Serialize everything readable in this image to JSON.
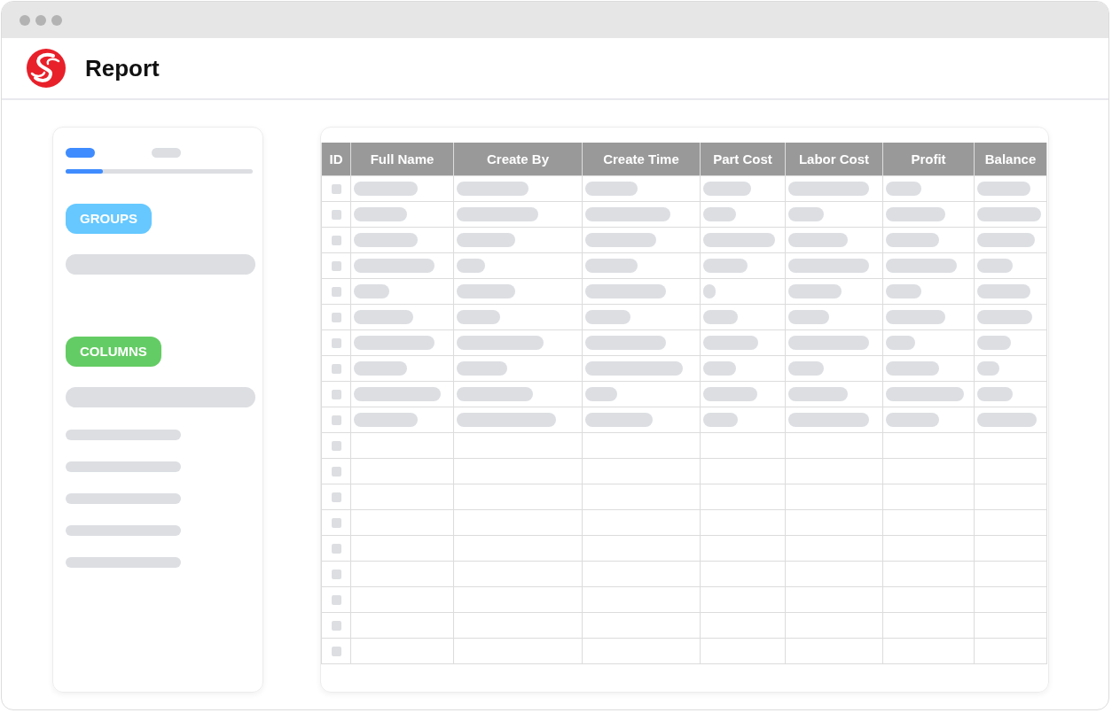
{
  "window": {
    "title": "Report"
  },
  "sidebar": {
    "tabs": [
      {
        "selected": true
      },
      {
        "selected": false
      }
    ],
    "progress": {
      "level": 0.2
    },
    "sections": [
      {
        "label": "GROUPS",
        "color": "#66c8ff",
        "items": [
          {
            "kind": "field"
          }
        ]
      },
      {
        "label": "COLUMNS",
        "color": "#64cc64",
        "items": [
          {
            "kind": "field"
          },
          {
            "kind": "line"
          },
          {
            "kind": "line"
          },
          {
            "kind": "line"
          },
          {
            "kind": "line"
          },
          {
            "kind": "line"
          }
        ]
      }
    ]
  },
  "table": {
    "columns": [
      "ID",
      "Full Name",
      "Create By",
      "Create Time",
      "Part Cost",
      "Labor Cost",
      "Profit",
      "Balance"
    ],
    "rows": [
      {
        "kind": "skeleton"
      },
      {
        "kind": "skeleton"
      },
      {
        "kind": "skeleton"
      },
      {
        "kind": "skeleton"
      },
      {
        "kind": "skeleton"
      },
      {
        "kind": "skeleton"
      },
      {
        "kind": "skeleton"
      },
      {
        "kind": "skeleton"
      },
      {
        "kind": "skeleton"
      },
      {
        "kind": "skeleton"
      },
      {
        "kind": "empty"
      },
      {
        "kind": "empty"
      },
      {
        "kind": "empty"
      },
      {
        "kind": "empty"
      },
      {
        "kind": "empty"
      },
      {
        "kind": "empty"
      },
      {
        "kind": "empty"
      },
      {
        "kind": "empty"
      },
      {
        "kind": "empty"
      }
    ]
  }
}
